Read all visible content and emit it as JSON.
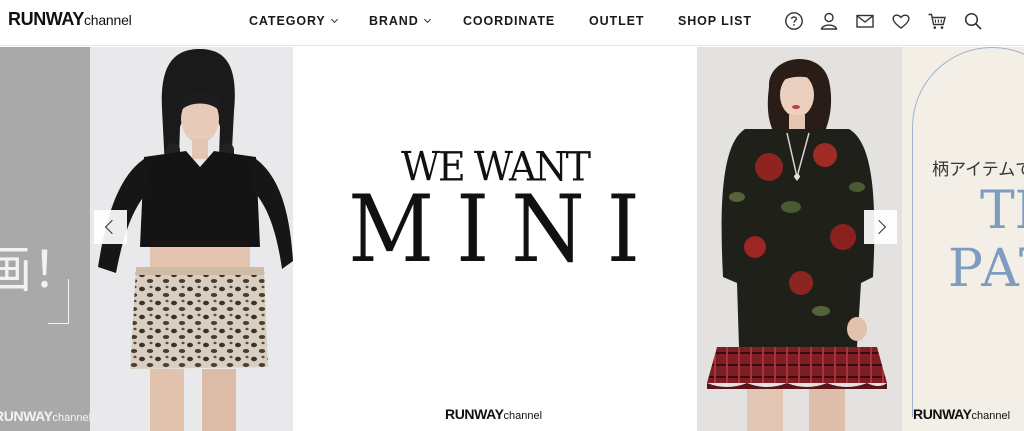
{
  "header": {
    "logo_strong": "RUNWAY",
    "logo_light": "channel",
    "nav": [
      {
        "label": "CATEGORY",
        "has_dropdown": true
      },
      {
        "label": "BRAND",
        "has_dropdown": true
      },
      {
        "label": "COORDINATE",
        "has_dropdown": false
      },
      {
        "label": "OUTLET",
        "has_dropdown": false
      },
      {
        "label": "SHOP LIST",
        "has_dropdown": false
      }
    ],
    "icons": [
      "help-icon",
      "user-icon",
      "mail-icon",
      "heart-icon",
      "cart-icon",
      "search-icon"
    ]
  },
  "carousel": {
    "left_slide": {
      "big_text": "画！",
      "logo_strong": "RUNWAY",
      "logo_light": "channel"
    },
    "center_slide": {
      "headline_top": "WE WANT",
      "headline_main": "MINI",
      "logo_strong": "RUNWAY",
      "logo_light": "channel"
    },
    "right_slide": {
      "jp_text": "柄アイテムで",
      "big_line_1": "TH",
      "big_line_2": "PAT",
      "logo_strong": "RUNWAY",
      "logo_light": "channel"
    }
  },
  "colors": {
    "accent_blue": "#7d9cc0",
    "text": "#111111"
  }
}
